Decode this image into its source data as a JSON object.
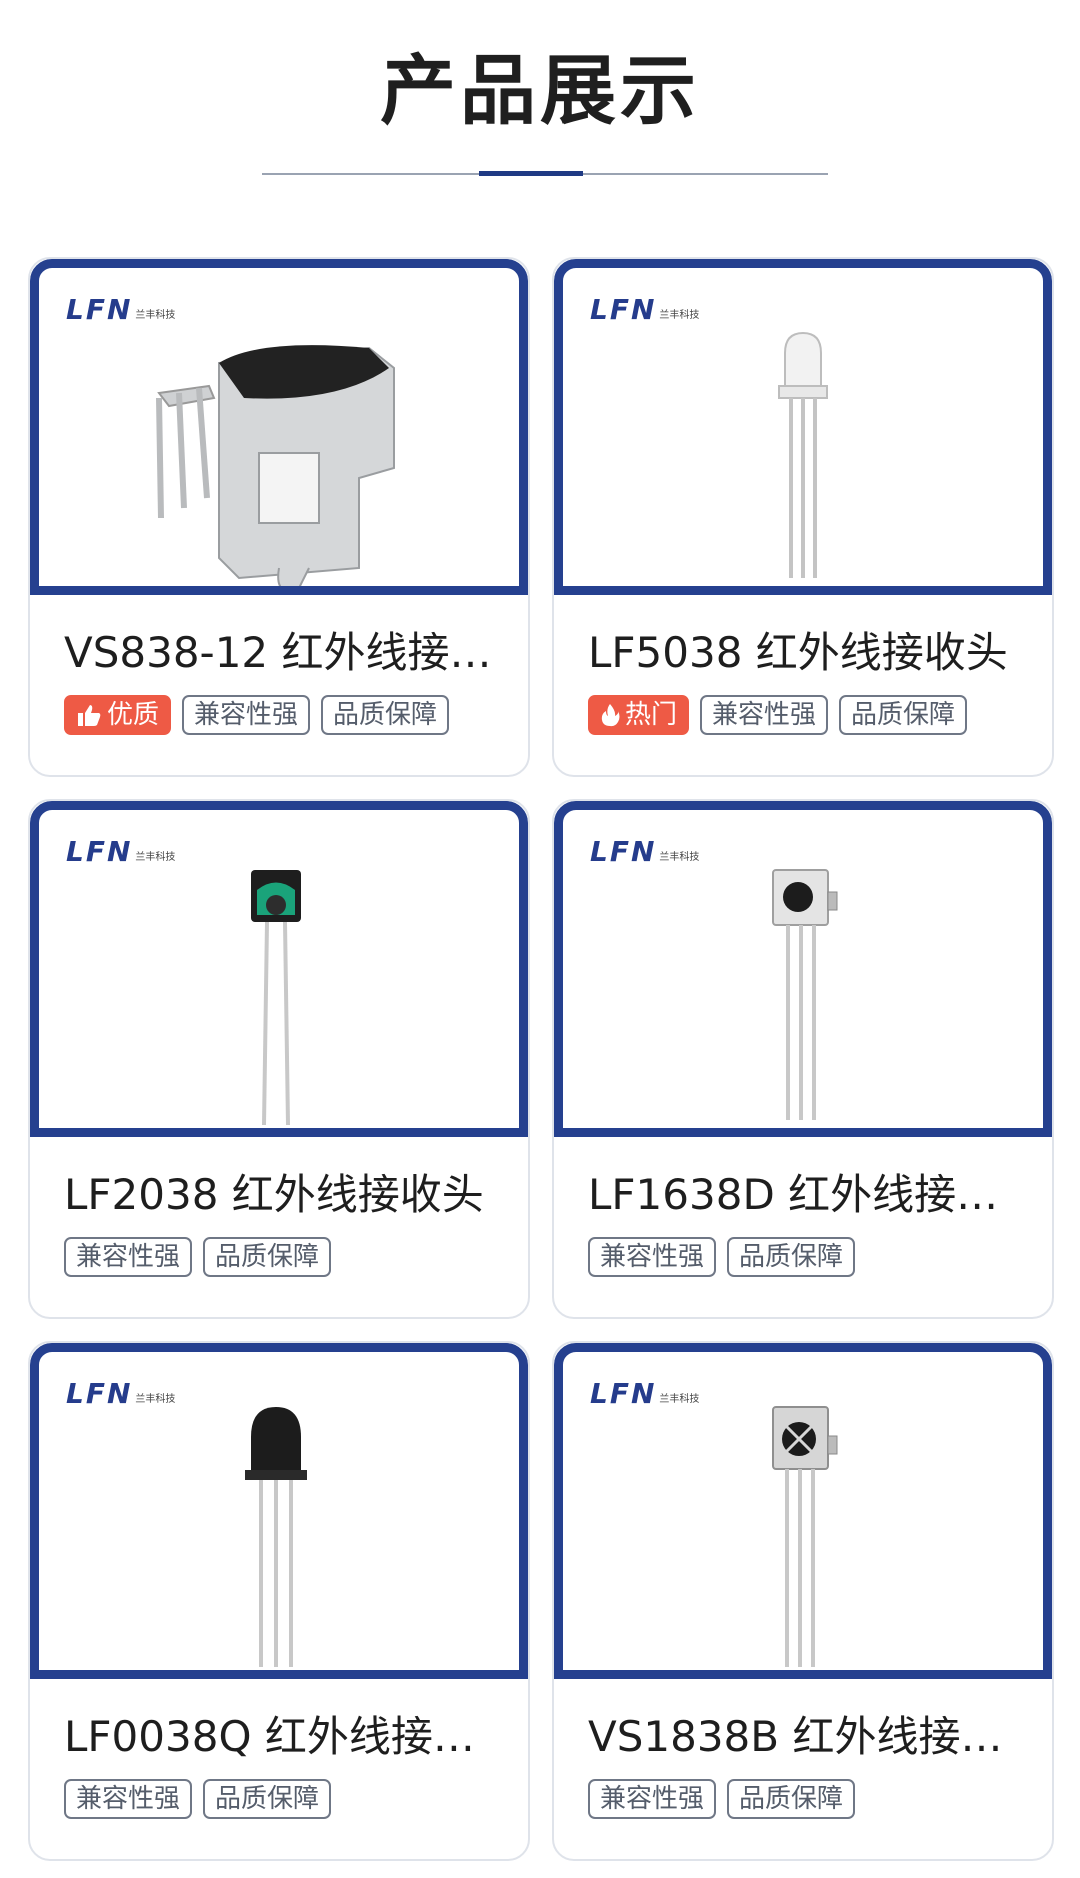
{
  "header": {
    "title": "产品展示"
  },
  "brand": {
    "logo_text": "LFN",
    "logo_sub": "兰丰科技"
  },
  "products": [
    {
      "name": "VS838-12 红外线接…",
      "badge": {
        "label": "优质",
        "icon": "thumbs-up-icon"
      },
      "tags": [
        "兼容性强",
        "品质保障"
      ]
    },
    {
      "name": "LF5038 红外线接收头",
      "badge": {
        "label": "热门",
        "icon": "flame-icon"
      },
      "tags": [
        "兼容性强",
        "品质保障"
      ]
    },
    {
      "name": "LF2038 红外线接收头",
      "tags": [
        "兼容性强",
        "品质保障"
      ]
    },
    {
      "name": "LF1638D 红外线接…",
      "tags": [
        "兼容性强",
        "品质保障"
      ]
    },
    {
      "name": "LF0038Q 红外线接…",
      "tags": [
        "兼容性强",
        "品质保障"
      ]
    },
    {
      "name": "VS1838B 红外线接…",
      "tags": [
        "兼容性强",
        "品质保障"
      ]
    }
  ],
  "colors": {
    "accent": "#25408f",
    "badge": "#ee5a45",
    "tag_border": "#6f7786"
  }
}
